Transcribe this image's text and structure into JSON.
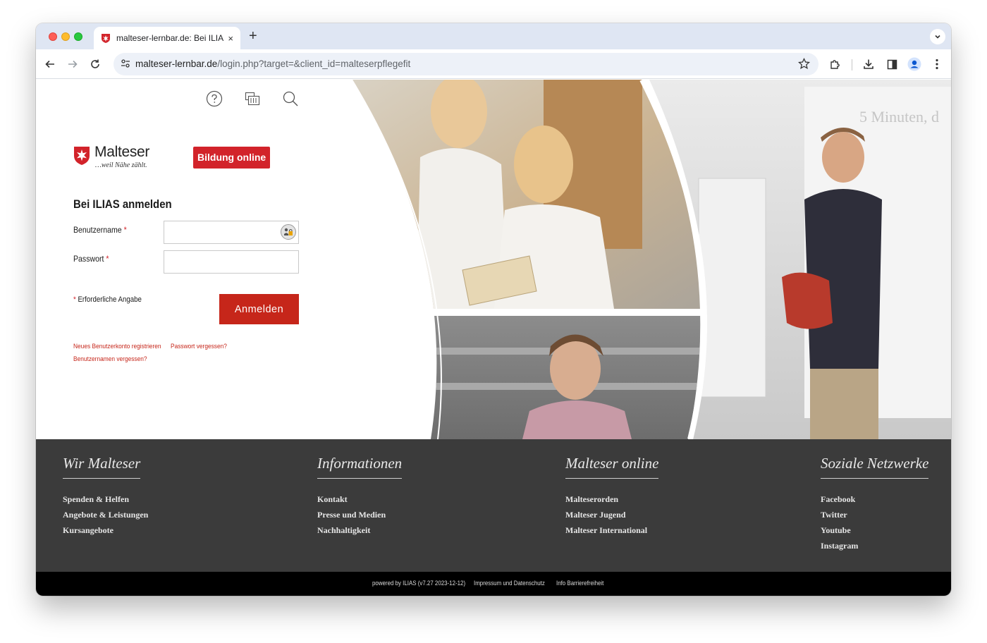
{
  "browser": {
    "tab_title": "malteser-lernbar.de: Bei ILIAS anmelden",
    "tab_close": "×",
    "new_tab": "+",
    "url_domain": "malteser-lernbar.de",
    "url_path": "/login.php?target=&client_id=malteserpflegefit"
  },
  "header": {
    "logo_name": "Malteser",
    "logo_tagline": "…weil Nähe zählt.",
    "logo_badge": "Bildung online"
  },
  "login": {
    "title": "Bei ILIAS anmelden",
    "username_label": "Benutzername",
    "password_label": "Passwort",
    "required_marker": "*",
    "username_value": "",
    "password_value": "",
    "required_note": "Erforderliche Angabe",
    "submit_label": "Anmelden",
    "register_link": "Neues Benutzerkonto registrieren",
    "forgot_password_link": "Passwort vergessen?",
    "forgot_username_link": "Benutzernamen vergessen?"
  },
  "footer": {
    "columns": [
      {
        "heading": "Wir Malteser",
        "links": [
          "Spenden & Helfen",
          "Angebote & Leistungen",
          "Kursangebote"
        ]
      },
      {
        "heading": "Informationen",
        "links": [
          "Kontakt",
          "Presse und Medien",
          "Nachhaltigkeit"
        ]
      },
      {
        "heading": "Malteser online",
        "links": [
          "Malteserorden",
          "Malteser Jugend",
          "Malteser International"
        ]
      },
      {
        "heading": "Soziale Netzwerke",
        "links": [
          "Facebook",
          "Twitter",
          "Youtube",
          "Instagram"
        ]
      }
    ]
  },
  "bottom_bar": {
    "powered_by": "powered by ILIAS (v7.27 2023-12-12)",
    "imprint": "Impressum und Datenschutz",
    "accessibility": "Info Barrierefreiheit"
  },
  "photo_text": {
    "whiteboard_line": "5 Minuten, d"
  },
  "colors": {
    "brand_red": "#d2232a",
    "button_red": "#c6261a",
    "footer_bg": "#3b3b3b",
    "bottom_bar_bg": "#000000"
  },
  "icons": {
    "help": "help-circle-icon",
    "clipboard": "clipboard-icon",
    "search": "search-icon",
    "password_assistant": "password-key-icon"
  }
}
